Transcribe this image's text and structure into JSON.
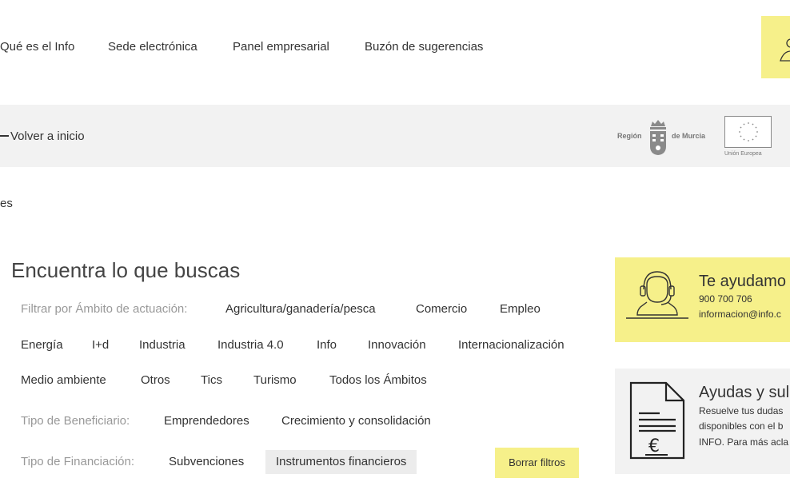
{
  "nav": {
    "items": [
      "Qué es el Info",
      "Sede electrónica",
      "Panel empresarial",
      "Buzón de sugerencias"
    ]
  },
  "graybar": {
    "back_label": "Volver a inicio",
    "logo_region_left": "Región",
    "logo_region_right": "de Murcia",
    "logo_eu": "Unión Europea"
  },
  "breadcrumb": "es",
  "finder": {
    "title": "Encuentra lo que buscas",
    "ambito_label": "Filtrar por Ámbito de actuación:",
    "ambito_row1": [
      "Agricultura/ganadería/pesca",
      "Comercio",
      "Empleo"
    ],
    "ambito_row2": [
      "Energía",
      "I+d",
      "Industria",
      "Industria 4.0",
      "Info",
      "Innovación",
      "Internacionalización"
    ],
    "ambito_row3": [
      "Medio ambiente",
      "Otros",
      "Tics",
      "Turismo",
      "Todos los Ámbitos"
    ],
    "beneficiario_label": "Tipo de Beneficiario:",
    "beneficiario": [
      "Emprendedores",
      "Crecimiento y consolidación"
    ],
    "financiacion_label": "Tipo de Financiación:",
    "financiacion": [
      "Subvenciones",
      "Instrumentos financieros"
    ],
    "clear_label": "Borrar filtros"
  },
  "cards": {
    "help": {
      "title": "Te ayudamo",
      "phone": "900 700 706",
      "email": "informacion@info.c"
    },
    "grants": {
      "title": "Ayudas y sul",
      "line1": "Resuelve tus dudas",
      "line2": "disponibles con el b",
      "line3": "INFO. Para más acla"
    }
  },
  "colors": {
    "accent_yellow": "#f6f08a",
    "bar_gray": "#f2f2f2",
    "active_chip": "#ececec"
  }
}
